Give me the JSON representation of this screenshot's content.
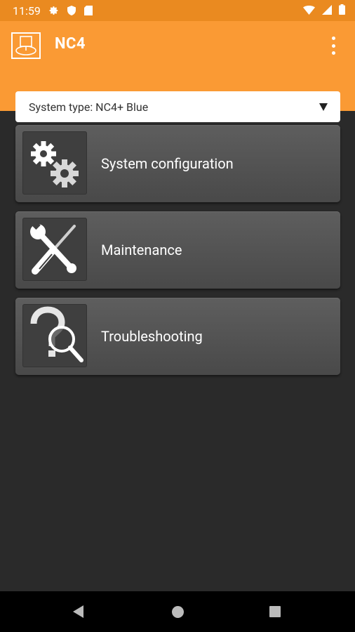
{
  "status_bar": {
    "time": "11:59",
    "icons": [
      "gear-icon",
      "shield-icon",
      "sim-card-icon",
      "wifi-icon",
      "signal-icon",
      "battery-icon"
    ]
  },
  "app_bar": {
    "title": "NC4",
    "logo_icon": "nc4-logo-icon",
    "overflow_icon": "more-vertical-icon",
    "background": "#fa9a34"
  },
  "system_type": {
    "selected": "System type: NC4+ Blue"
  },
  "menu": [
    {
      "label": "System configuration",
      "icon": "gears-icon"
    },
    {
      "label": "Maintenance",
      "icon": "wrench-screwdriver-icon"
    },
    {
      "label": "Troubleshooting",
      "icon": "question-magnifier-icon"
    }
  ],
  "nav_bar": {
    "icons": [
      "back-icon",
      "home-icon",
      "recents-icon"
    ]
  },
  "colors": {
    "accent": "#fa9a34",
    "status_bar": "#ea8a20",
    "background": "#2a2a2a",
    "card": "#555555"
  }
}
